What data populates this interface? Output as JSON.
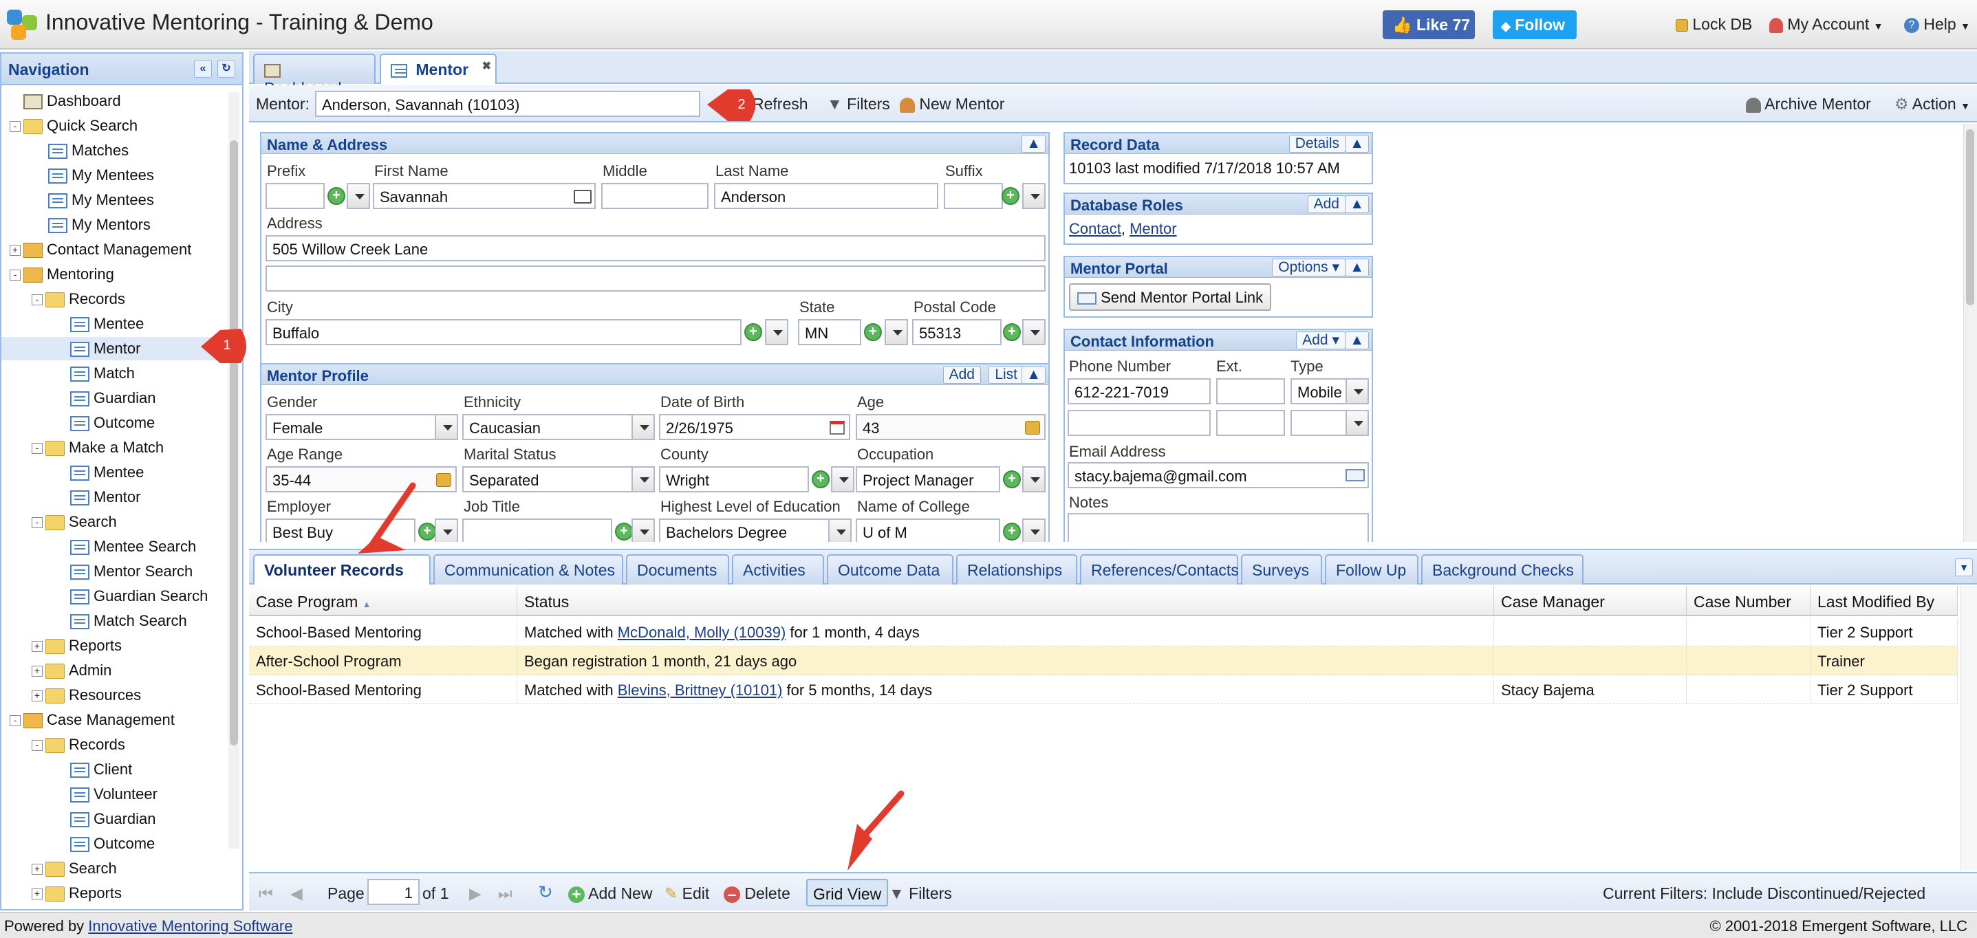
{
  "app": {
    "title": "Innovative Mentoring - Training & Demo"
  },
  "social": {
    "like": "Like 77",
    "follow": "Follow"
  },
  "topmenu": {
    "lock": "Lock DB",
    "account": "My Account",
    "help": "Help"
  },
  "nav": {
    "title": "Navigation",
    "items": [
      {
        "label": "Dashboard",
        "level": 0,
        "icon": "dashboard-icon"
      },
      {
        "label": "Quick Search",
        "level": 0,
        "icon": "folder-icon",
        "toggle": "-"
      },
      {
        "label": "Matches",
        "level": 1,
        "icon": "form-icon"
      },
      {
        "label": "My Mentees",
        "level": 1,
        "icon": "form-icon"
      },
      {
        "label": "My Mentees",
        "level": 1,
        "icon": "form-icon"
      },
      {
        "label": "My Mentors",
        "level": 1,
        "icon": "form-icon"
      },
      {
        "label": "Contact Management",
        "level": 0,
        "icon": "box-icon",
        "toggle": "+"
      },
      {
        "label": "Mentoring",
        "level": 0,
        "icon": "box-icon",
        "toggle": "-"
      },
      {
        "label": "Records",
        "level": 1,
        "icon": "folder-icon",
        "toggle": "-"
      },
      {
        "label": "Mentee",
        "level": 2,
        "icon": "form-icon"
      },
      {
        "label": "Mentor",
        "level": 2,
        "icon": "form-icon",
        "selected": true
      },
      {
        "label": "Match",
        "level": 2,
        "icon": "form-icon"
      },
      {
        "label": "Guardian",
        "level": 2,
        "icon": "form-icon"
      },
      {
        "label": "Outcome",
        "level": 2,
        "icon": "form-icon"
      },
      {
        "label": "Make a Match",
        "level": 1,
        "icon": "folder-icon",
        "toggle": "-"
      },
      {
        "label": "Mentee",
        "level": 2,
        "icon": "form-icon"
      },
      {
        "label": "Mentor",
        "level": 2,
        "icon": "form-icon"
      },
      {
        "label": "Search",
        "level": 1,
        "icon": "folder-icon",
        "toggle": "-"
      },
      {
        "label": "Mentee Search",
        "level": 2,
        "icon": "form-icon"
      },
      {
        "label": "Mentor Search",
        "level": 2,
        "icon": "form-icon"
      },
      {
        "label": "Guardian Search",
        "level": 2,
        "icon": "form-icon"
      },
      {
        "label": "Match Search",
        "level": 2,
        "icon": "form-icon"
      },
      {
        "label": "Reports",
        "level": 1,
        "icon": "folder-icon",
        "toggle": "+"
      },
      {
        "label": "Admin",
        "level": 1,
        "icon": "folder-icon",
        "toggle": "+"
      },
      {
        "label": "Resources",
        "level": 1,
        "icon": "folder-icon",
        "toggle": "+"
      },
      {
        "label": "Case Management",
        "level": 0,
        "icon": "box-icon",
        "toggle": "-"
      },
      {
        "label": "Records",
        "level": 1,
        "icon": "folder-icon",
        "toggle": "-"
      },
      {
        "label": "Client",
        "level": 2,
        "icon": "form-icon"
      },
      {
        "label": "Volunteer",
        "level": 2,
        "icon": "form-icon"
      },
      {
        "label": "Guardian",
        "level": 2,
        "icon": "form-icon"
      },
      {
        "label": "Outcome",
        "level": 2,
        "icon": "form-icon"
      },
      {
        "label": "Search",
        "level": 1,
        "icon": "folder-icon",
        "toggle": "+"
      },
      {
        "label": "Reports",
        "level": 1,
        "icon": "folder-icon",
        "toggle": "+"
      }
    ]
  },
  "tabs": {
    "dashboard": "Dashboard",
    "mentor": "Mentor"
  },
  "toolbar": {
    "mentor_label": "Mentor:",
    "mentor_value": "Anderson, Savannah (10103)",
    "refresh": "Refresh",
    "filters": "Filters",
    "new_mentor": "New Mentor",
    "archive": "Archive Mentor",
    "action": "Action"
  },
  "name_address": {
    "title": "Name & Address",
    "prefix_label": "Prefix",
    "first_label": "First Name",
    "middle_label": "Middle",
    "last_label": "Last Name",
    "suffix_label": "Suffix",
    "first": "Savannah",
    "last": "Anderson",
    "address_label": "Address",
    "address1": "505 Willow Creek Lane",
    "city_label": "City",
    "state_label": "State",
    "postal_label": "Postal Code",
    "city": "Buffalo",
    "state": "MN",
    "postal": "55313"
  },
  "profile": {
    "title": "Mentor Profile",
    "add": "Add",
    "list": "List",
    "gender_label": "Gender",
    "gender": "Female",
    "ethnicity_label": "Ethnicity",
    "ethnicity": "Caucasian",
    "dob_label": "Date of Birth",
    "dob": "2/26/1975",
    "age_label": "Age",
    "age": "43",
    "agerange_label": "Age Range",
    "agerange": "35-44",
    "marital_label": "Marital Status",
    "marital": "Separated",
    "county_label": "County",
    "county": "Wright",
    "occupation_label": "Occupation",
    "occupation": "Project Manager",
    "employer_label": "Employer",
    "employer": "Best Buy",
    "jobtitle_label": "Job Title",
    "education_label": "Highest Level of Education",
    "education": "Bachelors Degree",
    "college_label": "Name of College",
    "college": "U of M"
  },
  "record_data": {
    "title": "Record Data",
    "details": "Details",
    "text": "10103 last modified 7/17/2018 10:57 AM"
  },
  "db_roles": {
    "title": "Database Roles",
    "add": "Add",
    "role1": "Contact",
    "sep": ", ",
    "role2": "Mentor"
  },
  "portal": {
    "title": "Mentor Portal",
    "options": "Options",
    "send": "Send Mentor Portal Link"
  },
  "contact": {
    "title": "Contact Information",
    "add": "Add",
    "phone_label": "Phone Number",
    "ext_label": "Ext.",
    "type_label": "Type",
    "phone": "612-221-7019",
    "type": "Mobile",
    "email_label": "Email Address",
    "email": "stacy.bajema@gmail.com",
    "notes_label": "Notes"
  },
  "bottom_tabs": [
    "Volunteer Records",
    "Communication & Notes",
    "Documents",
    "Activities",
    "Outcome Data",
    "Relationships",
    "References/Contacts",
    "Surveys",
    "Follow Up",
    "Background Checks"
  ],
  "grid": {
    "columns": [
      "Case Program",
      "Status",
      "Case Manager",
      "Case Number",
      "Last Modified By"
    ],
    "rows": [
      {
        "program": "School-Based Mentoring",
        "status_pre": "Matched with ",
        "status_link": "McDonald, Molly (10039)",
        "status_post": " for 1 month, 4 days",
        "manager": "",
        "number": "",
        "modified": "Tier 2 Support"
      },
      {
        "program": "After-School Program",
        "status_pre": "Began registration 1 month, 21 days ago",
        "status_link": "",
        "status_post": "",
        "manager": "",
        "number": "",
        "modified": "Trainer"
      },
      {
        "program": "School-Based Mentoring",
        "status_pre": "Matched with ",
        "status_link": "Blevins, Brittney (10101)",
        "status_post": " for 5 months, 14 days",
        "manager": "Stacy Bajema",
        "number": "",
        "modified": "Tier 2 Support"
      }
    ]
  },
  "pager": {
    "page_label": "Page",
    "page": "1",
    "of": "of 1",
    "add_new": "Add New",
    "edit": "Edit",
    "delete": "Delete",
    "grid_view": "Grid View",
    "filters": "Filters",
    "current_filters": "Current Filters: Include Discontinued/Rejected"
  },
  "footer": {
    "powered": "Powered by ",
    "powered_link": "Innovative Mentoring Software",
    "copyright": "© 2001-2018 Emergent Software, LLC"
  },
  "annotations": {
    "badge1": "1",
    "badge2": "2"
  },
  "colors": {
    "accent": "#15428b",
    "panel_border": "#99bbe8",
    "highlight_row": "#fbf3cd",
    "annotation": "#e23b2e"
  }
}
